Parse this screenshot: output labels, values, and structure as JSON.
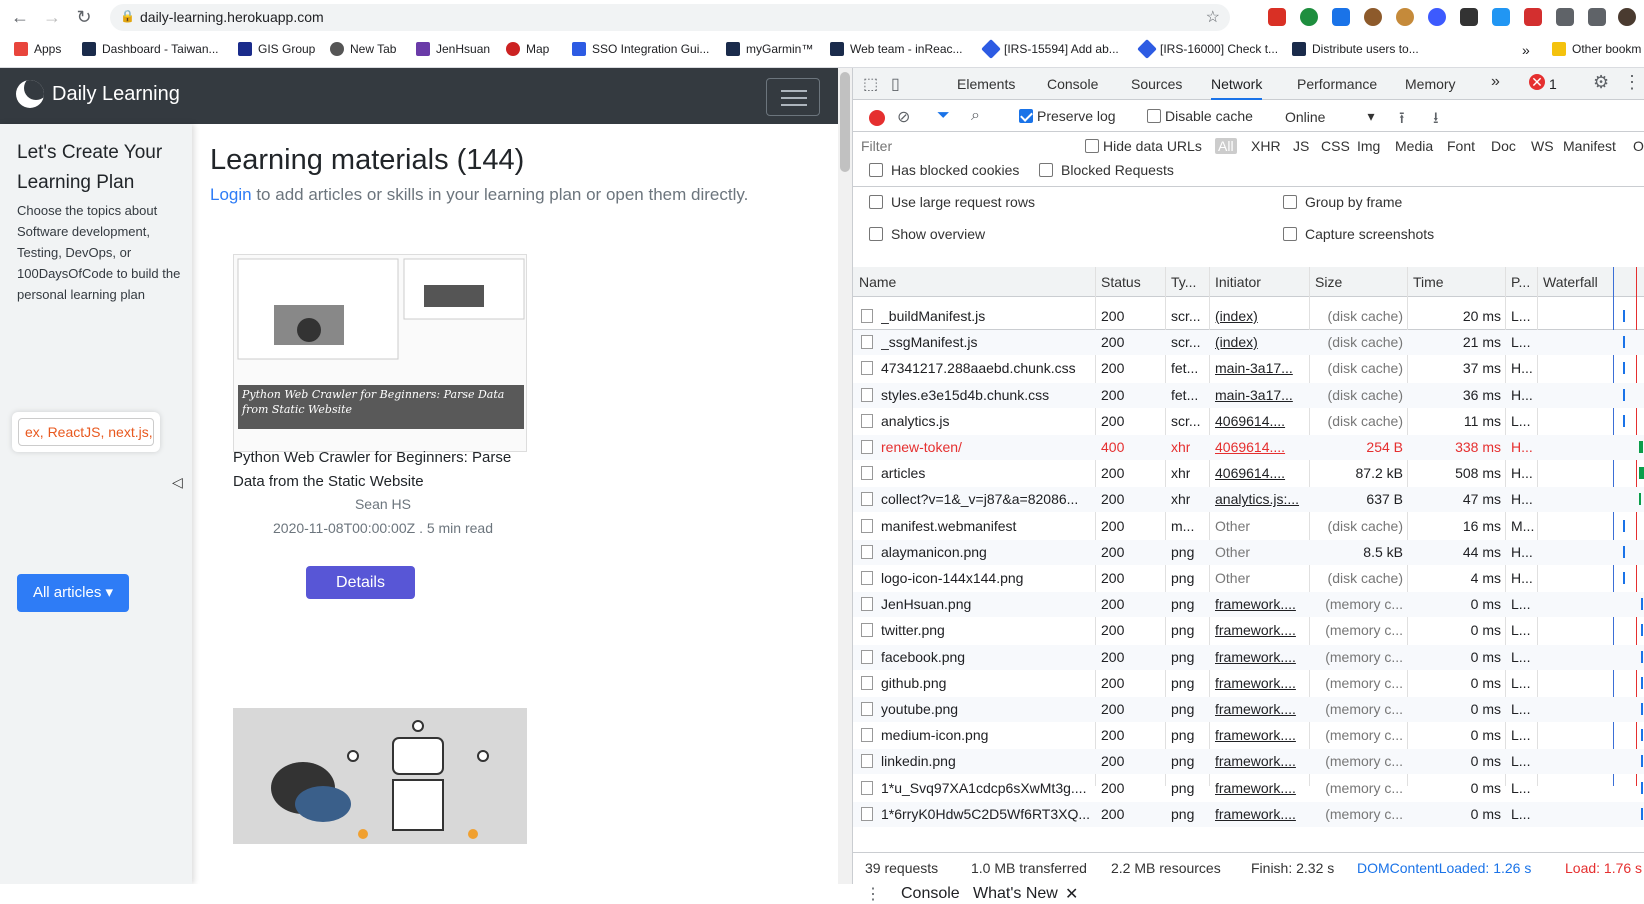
{
  "browser": {
    "url": "daily-learning.herokuapp.com",
    "bookmarks": [
      {
        "label": "Apps",
        "color": "#e8453c"
      },
      {
        "label": "Dashboard - Taiwan...",
        "color": "#1a2b4b"
      },
      {
        "label": "GIS Group",
        "color": "#1a2b8b"
      },
      {
        "label": "New Tab",
        "color": "#555555"
      },
      {
        "label": "JenHsuan",
        "color": "#6a3ba8"
      },
      {
        "label": "Map",
        "color": "#cc2222"
      },
      {
        "label": "SSO Integration Gui...",
        "color": "#2d5be3"
      },
      {
        "label": "myGarmin™",
        "color": "#1a2b4b"
      },
      {
        "label": "Web team - inReac...",
        "color": "#1a2b4b"
      },
      {
        "label": "[IRS-15594] Add ab...",
        "color": "#2d5be3"
      },
      {
        "label": "[IRS-16000] Check t...",
        "color": "#2d5be3"
      },
      {
        "label": "Distribute users to...",
        "color": "#1a2b4b"
      }
    ],
    "bookmarks_overflow": "»",
    "other_bookmarks": "Other bookm"
  },
  "page": {
    "brand": "Daily Learning",
    "sidebar_title": "Let's Create Your Learning Plan",
    "sidebar_desc": "Choose the topics about Software development, Testing, DevOps, or 100DaysOfCode to build the personal learning plan",
    "search_value": "ex, ReactJS, next.js,",
    "all_articles": "All articles",
    "main_title": "Learning materials (144)",
    "login_link": "Login",
    "login_rest": " to add articles or skills in your learning plan or open them directly.",
    "card1": {
      "caption": "Python Web Crawler for Beginners: Parse Data from Static Website",
      "title": "Python Web Crawler for Beginners: Parse Data from the Static Website",
      "author": "Sean HS",
      "date": "2020-11-08T00:00:00Z . 5 min read",
      "details": "Details"
    }
  },
  "devtools": {
    "tabs": [
      "Elements",
      "Console",
      "Sources",
      "Network",
      "Performance",
      "Memory"
    ],
    "more_tabs": "»",
    "error_count": "1",
    "toolbar": {
      "preserve_log": "Preserve log",
      "disable_cache": "Disable cache",
      "throttle": "Online"
    },
    "filter_placeholder": "Filter",
    "hide_data_urls": "Hide data URLs",
    "filter_types": [
      "All",
      "XHR",
      "JS",
      "CSS",
      "Img",
      "Media",
      "Font",
      "Doc",
      "WS",
      "Manifest",
      "O"
    ],
    "has_blocked_cookies": "Has blocked cookies",
    "blocked_requests": "Blocked Requests",
    "use_large_rows": "Use large request rows",
    "show_overview": "Show overview",
    "group_by_frame": "Group by frame",
    "capture_screenshots": "Capture screenshots",
    "columns": [
      "Name",
      "Status",
      "Ty...",
      "Initiator",
      "Size",
      "Time",
      "P...",
      "Waterfall"
    ],
    "rows": [
      {
        "name": "_buildManifest.js",
        "status": "200",
        "type": "scr...",
        "initiator": "(index)",
        "size": "(disk cache)",
        "time": "20 ms",
        "p": "L..."
      },
      {
        "name": "_ssgManifest.js",
        "status": "200",
        "type": "scr...",
        "initiator": "(index)",
        "size": "(disk cache)",
        "time": "21 ms",
        "p": "L..."
      },
      {
        "name": "47341217.288aaebd.chunk.css",
        "status": "200",
        "type": "fet...",
        "initiator": "main-3a17...",
        "size": "(disk cache)",
        "time": "37 ms",
        "p": "H..."
      },
      {
        "name": "styles.e3e15d4b.chunk.css",
        "status": "200",
        "type": "fet...",
        "initiator": "main-3a17...",
        "size": "(disk cache)",
        "time": "36 ms",
        "p": "H..."
      },
      {
        "name": "analytics.js",
        "status": "200",
        "type": "scr...",
        "initiator": "4069614....",
        "size": "(disk cache)",
        "time": "11 ms",
        "p": "L..."
      },
      {
        "name": "renew-token/",
        "status": "400",
        "type": "xhr",
        "initiator": "4069614....",
        "size": "254 B",
        "time": "338 ms",
        "p": "H..."
      },
      {
        "name": "articles",
        "status": "200",
        "type": "xhr",
        "initiator": "4069614....",
        "size": "87.2 kB",
        "time": "508 ms",
        "p": "H..."
      },
      {
        "name": "collect?v=1&_v=j87&a=82086...",
        "status": "200",
        "type": "xhr",
        "initiator": "analytics.js:...",
        "size": "637 B",
        "time": "47 ms",
        "p": "H..."
      },
      {
        "name": "manifest.webmanifest",
        "status": "200",
        "type": "m...",
        "initiator": "Other",
        "size": "(disk cache)",
        "time": "16 ms",
        "p": "M..."
      },
      {
        "name": "alaymanicon.png",
        "status": "200",
        "type": "png",
        "initiator": "Other",
        "size": "8.5 kB",
        "time": "44 ms",
        "p": "H..."
      },
      {
        "name": "logo-icon-144x144.png",
        "status": "200",
        "type": "png",
        "initiator": "Other",
        "size": "(disk cache)",
        "time": "4 ms",
        "p": "H..."
      },
      {
        "name": "JenHsuan.png",
        "status": "200",
        "type": "png",
        "initiator": "framework....",
        "size": "(memory c...",
        "time": "0 ms",
        "p": "L..."
      },
      {
        "name": "twitter.png",
        "status": "200",
        "type": "png",
        "initiator": "framework....",
        "size": "(memory c...",
        "time": "0 ms",
        "p": "L..."
      },
      {
        "name": "facebook.png",
        "status": "200",
        "type": "png",
        "initiator": "framework....",
        "size": "(memory c...",
        "time": "0 ms",
        "p": "L..."
      },
      {
        "name": "github.png",
        "status": "200",
        "type": "png",
        "initiator": "framework....",
        "size": "(memory c...",
        "time": "0 ms",
        "p": "L..."
      },
      {
        "name": "youtube.png",
        "status": "200",
        "type": "png",
        "initiator": "framework....",
        "size": "(memory c...",
        "time": "0 ms",
        "p": "L..."
      },
      {
        "name": "medium-icon.png",
        "status": "200",
        "type": "png",
        "initiator": "framework....",
        "size": "(memory c...",
        "time": "0 ms",
        "p": "L..."
      },
      {
        "name": "linkedin.png",
        "status": "200",
        "type": "png",
        "initiator": "framework....",
        "size": "(memory c...",
        "time": "0 ms",
        "p": "L..."
      },
      {
        "name": "1*u_Svq97XA1cdcp6sXwMt3g....",
        "status": "200",
        "type": "png",
        "initiator": "framework....",
        "size": "(memory c...",
        "time": "0 ms",
        "p": "L..."
      },
      {
        "name": "1*6rryK0Hdw5C2D5Wf6RT3XQ...",
        "status": "200",
        "type": "png",
        "initiator": "framework....",
        "size": "(memory c...",
        "time": "0 ms",
        "p": "L..."
      }
    ],
    "status_bar": {
      "requests": "39 requests",
      "transferred": "1.0 MB transferred",
      "resources": "2.2 MB resources",
      "finish": "Finish: 2.32 s",
      "dcl": "DOMContentLoaded: 1.26 s",
      "load": "Load: 1.76 s"
    },
    "drawer_tabs": [
      "Console",
      "What's New"
    ]
  }
}
